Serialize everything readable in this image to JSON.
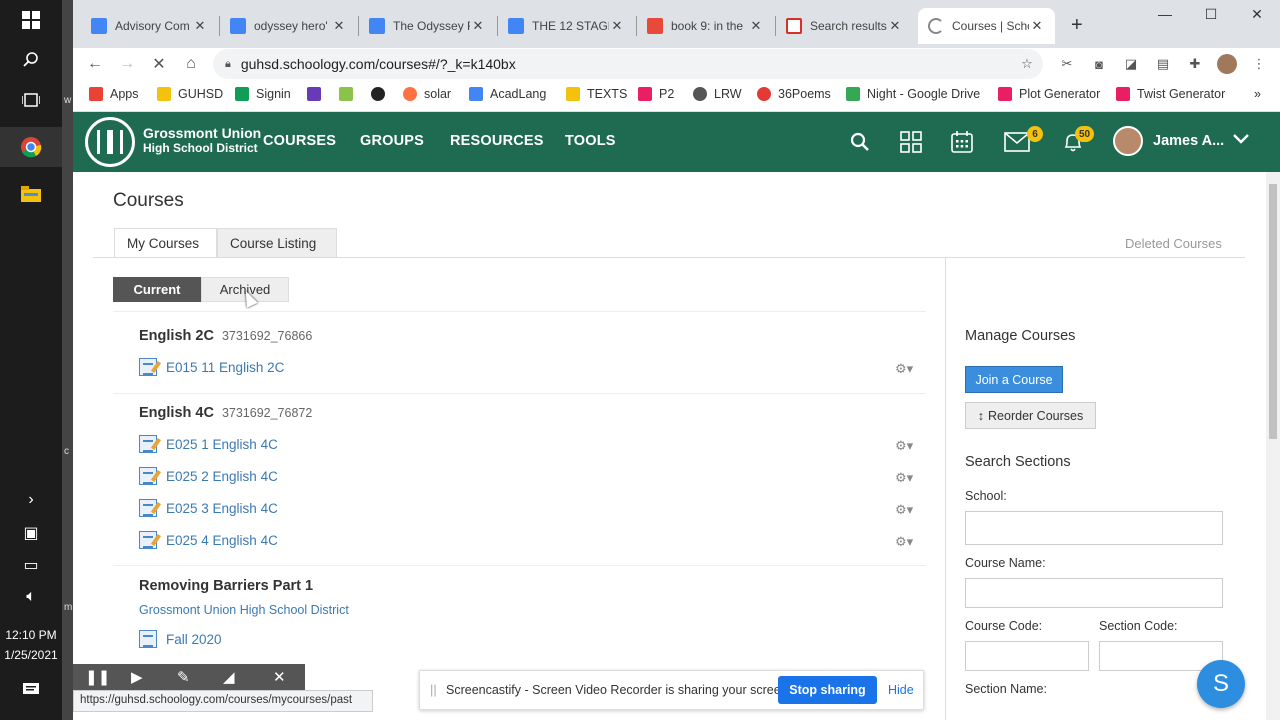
{
  "taskbar": {
    "time": "12:10 PM",
    "date": "1/25/2021",
    "side_text_1": "w",
    "side_text_2": "c",
    "side_text_3": "m"
  },
  "tabs": [
    {
      "label": "Advisory Com",
      "icon_color": "#4285f4",
      "icon": "docs-icon"
    },
    {
      "label": "odyssey hero'",
      "icon_color": "#4285f4",
      "icon": "docs-icon"
    },
    {
      "label": "The Odyssey F",
      "icon_color": "#4285f4",
      "icon": "docs-icon"
    },
    {
      "label": "THE 12 STAGE",
      "icon_color": "#4285f4",
      "icon": "docs-icon"
    },
    {
      "label": "book 9: in the",
      "icon_color": "#e84a3a",
      "icon": "slides-icon"
    },
    {
      "label": "Search results",
      "icon_color": "#d93025",
      "icon": "gmail-icon"
    },
    {
      "label": "Courses | Scho",
      "icon_color": "#888888",
      "icon": "loading-icon"
    }
  ],
  "address_bar": {
    "url": "guhsd.schoology.com/courses#/?_k=k140bx"
  },
  "bookmarks": [
    {
      "label": "Apps",
      "color": "#ea4335"
    },
    {
      "label": "GUHSD",
      "color": "#f4c20d"
    },
    {
      "label": "Signin",
      "color": "#0f9d58"
    },
    {
      "label": "",
      "color": "#673ab7"
    },
    {
      "label": "",
      "color": "#8bc34a"
    },
    {
      "label": "",
      "color": "#222222"
    },
    {
      "label": "solar",
      "color": "#ff7043"
    },
    {
      "label": "AcadLang",
      "color": "#4285f4"
    },
    {
      "label": "TEXTS",
      "color": "#f4c20d"
    },
    {
      "label": "P2",
      "color": "#e91e63"
    },
    {
      "label": "LRW",
      "color": "#555555"
    },
    {
      "label": "36Poems",
      "color": "#e53935"
    },
    {
      "label": "Night - Google Drive",
      "color": "#34a853"
    },
    {
      "label": "Plot Generator",
      "color": "#e91e63"
    },
    {
      "label": "Twist Generator",
      "color": "#e91e63"
    }
  ],
  "header": {
    "logo_line1": "Grossmont Union",
    "logo_line2": "High School District",
    "nav": [
      "COURSES",
      "GROUPS",
      "RESOURCES",
      "TOOLS"
    ],
    "messages_badge": "6",
    "notifications_badge": "50",
    "user_name": "James A..."
  },
  "page": {
    "title": "Courses",
    "tab_my_courses": "My Courses",
    "tab_course_listing": "Course Listing",
    "deleted_courses": "Deleted Courses",
    "seg_current": "Current",
    "seg_archived": "Archived"
  },
  "courses": [
    {
      "title": "English 2C",
      "code": "3731692_76866",
      "sections": [
        "E015 11 English 2C"
      ]
    },
    {
      "title": "English 4C",
      "code": "3731692_76872",
      "sections": [
        "E025 1 English 4C",
        "E025 2 English 4C",
        "E025 3 English 4C",
        "E025 4 English 4C"
      ]
    },
    {
      "title": "Removing Barriers Part 1",
      "org": "Grossmont Union High School District",
      "sections": [
        "Fall 2020"
      ]
    }
  ],
  "sidebar": {
    "manage_title": "Manage Courses",
    "join_button": "Join a Course",
    "reorder_button": "Reorder Courses",
    "search_title": "Search Sections",
    "school_label": "School:",
    "course_name_label": "Course Name:",
    "course_code_label": "Course Code:",
    "section_code_label": "Section Code:",
    "section_name_label": "Section Name:"
  },
  "screencastify": {
    "status_url": "https://guhsd.schoology.com/courses/mycourses/past",
    "share_text": "Screencastify - Screen Video Recorder is sharing your screen.",
    "stop_button": "Stop sharing",
    "hide_button": "Hide"
  },
  "fab_letter": "S"
}
